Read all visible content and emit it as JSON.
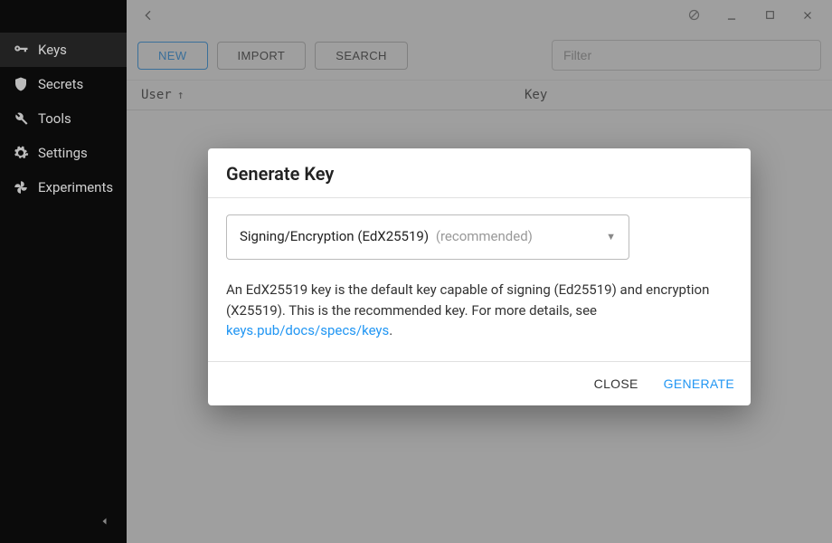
{
  "sidebar": {
    "items": [
      {
        "label": "Keys"
      },
      {
        "label": "Secrets"
      },
      {
        "label": "Tools"
      },
      {
        "label": "Settings"
      },
      {
        "label": "Experiments"
      }
    ]
  },
  "toolbar": {
    "new_label": "NEW",
    "import_label": "IMPORT",
    "search_label": "SEARCH",
    "filter_placeholder": "Filter"
  },
  "table": {
    "col_user": "User",
    "col_key": "Key"
  },
  "dialog": {
    "title": "Generate Key",
    "select_label": "Signing/Encryption (EdX25519)",
    "select_hint": "(recommended)",
    "description_pre": "An EdX25519 key is the default key capable of signing (Ed25519) and encryption (X25519). This is the recommended key. For more details, see ",
    "description_link": "keys.pub/docs/specs/keys",
    "description_post": ".",
    "close_label": "CLOSE",
    "generate_label": "GENERATE"
  }
}
